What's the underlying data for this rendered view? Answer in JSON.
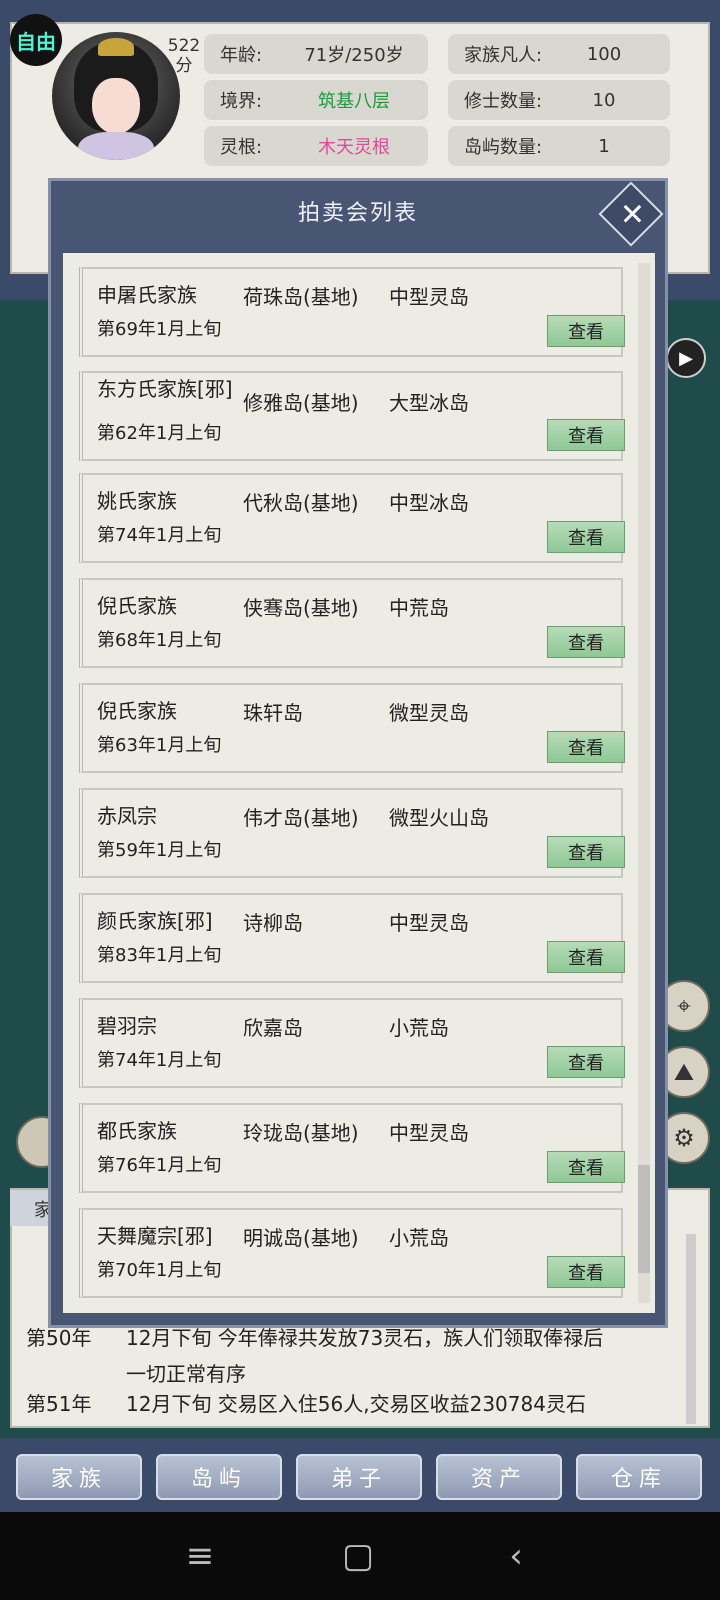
{
  "header": {
    "mode": "自由",
    "score": "522",
    "score_unit": "分",
    "stats": [
      {
        "key": "年龄:",
        "value": "71岁/250岁"
      },
      {
        "key": "家族凡人:",
        "value": "100"
      },
      {
        "key": "境界:",
        "value": "筑基八层"
      },
      {
        "key": "修士数量:",
        "value": "10"
      },
      {
        "key": "灵根:",
        "value": "木天灵根"
      },
      {
        "key": "岛屿数量:",
        "value": "1"
      }
    ]
  },
  "modal": {
    "title": "拍卖会列表",
    "view_label": "查看",
    "items": [
      {
        "family": "申屠氏家族",
        "island": "荷珠岛(基地)",
        "type": "中型灵岛",
        "date": "第69年1月上旬"
      },
      {
        "family": "东方氏家族[邪]",
        "island": "修雅岛(基地)",
        "type": "大型冰岛",
        "date": "第62年1月上旬"
      },
      {
        "family": "姚氏家族",
        "island": "代秋岛(基地)",
        "type": "中型冰岛",
        "date": "第74年1月上旬"
      },
      {
        "family": "倪氏家族",
        "island": "侠骞岛(基地)",
        "type": "中荒岛",
        "date": "第68年1月上旬"
      },
      {
        "family": "倪氏家族",
        "island": "珠轩岛",
        "type": "微型灵岛",
        "date": "第63年1月上旬"
      },
      {
        "family": "赤凤宗",
        "island": "伟才岛(基地)",
        "type": "微型火山岛",
        "date": "第59年1月上旬"
      },
      {
        "family": "颜氏家族[邪]",
        "island": "诗柳岛",
        "type": "中型灵岛",
        "date": "第83年1月上旬"
      },
      {
        "family": "碧羽宗",
        "island": "欣嘉岛",
        "type": "小荒岛",
        "date": "第74年1月上旬"
      },
      {
        "family": "都氏家族",
        "island": "玲珑岛(基地)",
        "type": "中型灵岛",
        "date": "第76年1月上旬"
      },
      {
        "family": "天舞魔宗[邪]",
        "island": "明诚岛(基地)",
        "type": "小荒岛",
        "date": "第70年1月上旬"
      }
    ]
  },
  "log": {
    "tab": "家",
    "lines": [
      {
        "year": "第50年",
        "text": "12月下旬 今年俸禄共发放73灵石，族人们领取俸禄后"
      },
      {
        "year": "",
        "text": "一切正常有序"
      },
      {
        "year": "第51年",
        "text": "12月下旬 交易区入住56人,交易区收益230784灵石"
      }
    ]
  },
  "nav": [
    "家族",
    "岛屿",
    "弟子",
    "资产",
    "仓库"
  ]
}
